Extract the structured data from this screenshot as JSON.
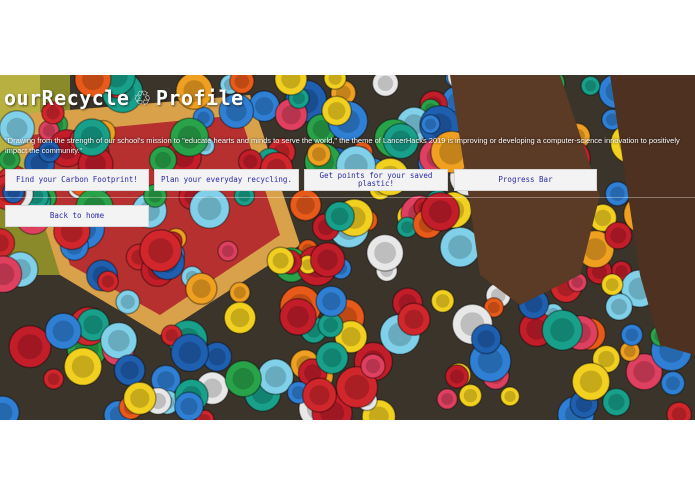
{
  "header": {
    "title_part1": "ourRecycle",
    "title_icon": "recycle-icon",
    "title_icon_glyph": "♲",
    "title_part2": "Profile"
  },
  "mission_text": "\"Drawing from the strength of our school's mission to \"educate hearts and minds to serve the world,\" the theme of LancerHacks 2019 is improving or developing a computer-science innovation to positively impact the community.\"",
  "nav": {
    "carbon_footprint": "Find your Carbon Footprint!",
    "plan_recycling": "Plan your everyday recycling.",
    "saved_plastic": "Get points for your saved plastic!",
    "progress_bar": "Progress Bar",
    "back_home": "Back to home"
  },
  "colors": {
    "button_text": "#2a2aa8",
    "button_bg": "#f3f3f3",
    "title_text": "#ffffff"
  }
}
